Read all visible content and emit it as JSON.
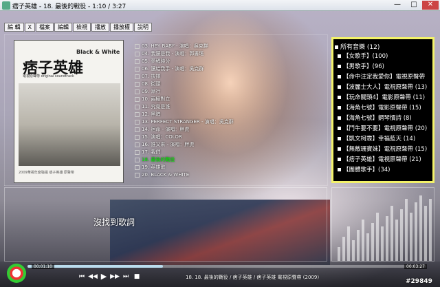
{
  "window": {
    "title": "痞子英雄 - 18. 最後的戰役 - 1:10 / 3:27",
    "min": "—",
    "max": "□",
    "close": "✕"
  },
  "menu": [
    "編 輯",
    "X",
    "檔案",
    "編輯",
    "檢視",
    "播放",
    "播放權",
    "說明"
  ],
  "album": {
    "title": "痞子英雄",
    "brand": "Black & White",
    "subtitle": "電視原聲帶 original soundtrack",
    "caption": "2009華視年度強檔 痞子英雄 原聲帶"
  },
  "playlist": {
    "tracks": [
      "03. HEY BABY - 演唱：吳克群",
      "04. 我還是我 - 演唱：郭書瑤",
      "05. 夢醒時分",
      "06. 還給我手 - 演唱：吳克群",
      "07. 抉擇",
      "08. 街頭",
      "09. 漸行",
      "10. 兩極對立",
      "11. 究竟是誰",
      "12. 黑暗",
      "13. PERFECT STRANGER - 演唱：吳克群",
      "14. 宿命 - 演唱：胖虎",
      "15. 演唱：COLOR",
      "16. 誰又來 - 演唱：胖虎",
      "17. 我們",
      "18. 最後的戰役",
      "19. 英雄歌",
      "20. BLACK & WHITE"
    ],
    "active_index": 15
  },
  "tree": {
    "root": "所有音樂 (12)",
    "items": [
      "【女歌手】(100)",
      "【男歌手】(96)",
      "【命中注定我愛你】電視原聲帶",
      "【波麗士大人】電視原聲帶 (13)",
      "【玩命關頭4】電影原聲帶 (11)",
      "【海角七號】電影原聲帶 (15)",
      "【海角七號】鋼琴慣詩 (8)",
      "【鬥牛要不要】電視原聲帶 (20)",
      "【凱文柯霖】幸福藍天 (14)",
      "【無敵珊寶妹】電視原聲帶 (15)",
      "【痞子英雄】電視原聲帶 (21)",
      "【團體歌手】(34)"
    ]
  },
  "lyric": "沒找到歌詞",
  "player": {
    "elapsed": "00:01:10",
    "total": "00:03:27",
    "progress": 0.34,
    "status": "18. 18. 最後的戰役 / 痞子英雄 / 痞子英雄 電視原聲帶 (2009)",
    "buttons": [
      "⏮",
      "◀◀",
      "▶",
      "▶▶",
      "⏭",
      "■"
    ]
  },
  "eq_levels": [
    0.2,
    0.35,
    0.5,
    0.3,
    0.45,
    0.6,
    0.4,
    0.55,
    0.7,
    0.5,
    0.65,
    0.8,
    0.6,
    0.75,
    0.9,
    0.7,
    0.85,
    0.95,
    0.8,
    0.9
  ],
  "watermark": "#29849"
}
